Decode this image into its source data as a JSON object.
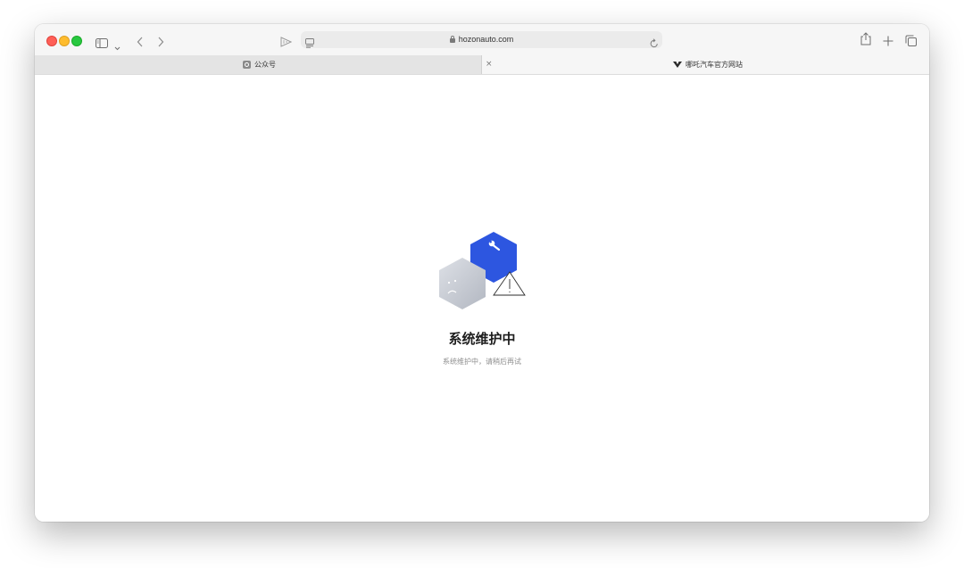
{
  "browser": {
    "url": "hozonauto.com",
    "tabs": [
      {
        "label": "公众号",
        "active": false
      },
      {
        "label": "哪吒汽车官方网站",
        "active": true
      }
    ],
    "tab_close_glyph": "×"
  },
  "page": {
    "title": "系统维护中",
    "message": "系统维护中，请稍后再试"
  },
  "icons": {
    "toolbar": [
      "sidebar-icon",
      "chevron-down-icon",
      "back-icon",
      "forward-icon",
      "page-tools-icon",
      "reader-icon",
      "lock-icon",
      "reload-icon",
      "share-icon",
      "new-tab-icon",
      "tab-overview-icon"
    ],
    "illustration": [
      "gray-hexagon-sad-face",
      "blue-hexagon-wrench",
      "warning-triangle-icon"
    ]
  },
  "colors": {
    "accent_blue": "#2d56e0",
    "traffic_close": "#ff5f57",
    "traffic_minimize": "#febc2e",
    "traffic_maximize": "#28c840"
  }
}
